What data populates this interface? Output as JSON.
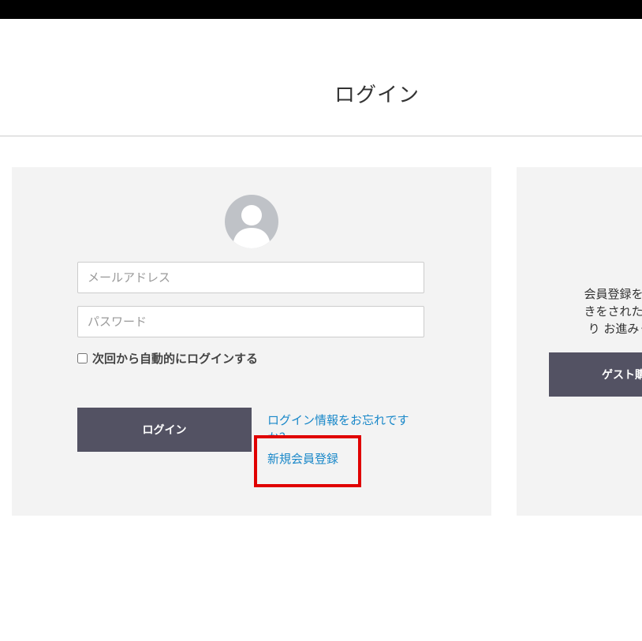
{
  "header": {
    "title": "ログイン"
  },
  "login": {
    "email_placeholder": "メールアドレス",
    "password_placeholder": "パスワード",
    "remember_label": "次回から自動的にログインする",
    "submit_label": "ログイン",
    "forgot_link": "ログイン情報をお忘れですか？",
    "register_link": "新規会員登録"
  },
  "guest": {
    "description_lines": [
      "会員登録をせず",
      "きをされたい方",
      "り お進みくだ"
    ],
    "button_label": "ゲスト購"
  },
  "colors": {
    "button_bg": "#535263",
    "link": "#1a88c9",
    "panel_bg": "#f3f3f3",
    "highlight": "#e00000"
  }
}
